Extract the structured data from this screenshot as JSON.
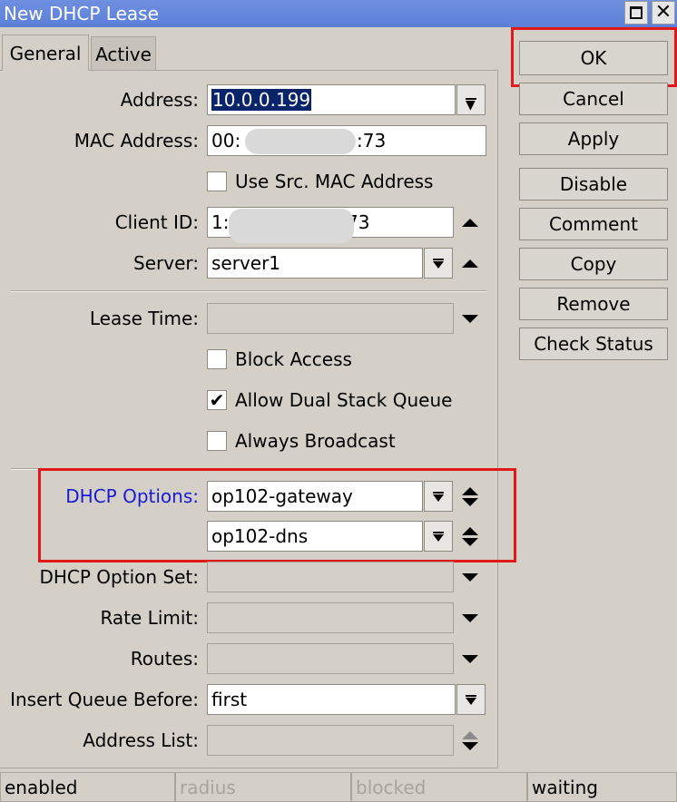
{
  "window": {
    "title": "New DHCP Lease"
  },
  "tabs": [
    {
      "label": "General"
    },
    {
      "label": "Active"
    }
  ],
  "form": {
    "address": {
      "label": "Address:",
      "value": "10.0.0.199"
    },
    "mac": {
      "label": "MAC Address:",
      "value_start": "00:",
      "value_end": ":73"
    },
    "use_src_mac": {
      "label": "Use Src. MAC Address",
      "checked": false
    },
    "client_id": {
      "label": "Client ID:",
      "value_start": "1:",
      "value_end": "73"
    },
    "server": {
      "label": "Server:",
      "value": "server1"
    },
    "lease_time": {
      "label": "Lease Time:",
      "value": ""
    },
    "block_access": {
      "label": "Block Access",
      "checked": false
    },
    "allow_dual_stack": {
      "label": "Allow Dual Stack Queue",
      "checked": true
    },
    "always_broadcast": {
      "label": "Always Broadcast",
      "checked": false
    },
    "dhcp_options": {
      "label": "DHCP Options:",
      "values": [
        "op102-gateway",
        "op102-dns"
      ]
    },
    "dhcp_option_set": {
      "label": "DHCP Option Set:",
      "value": ""
    },
    "rate_limit": {
      "label": "Rate Limit:",
      "value": ""
    },
    "routes": {
      "label": "Routes:",
      "value": ""
    },
    "insert_queue_before": {
      "label": "Insert Queue Before:",
      "value": "first"
    },
    "address_list": {
      "label": "Address List:",
      "value": ""
    }
  },
  "buttons": {
    "ok": "OK",
    "cancel": "Cancel",
    "apply": "Apply",
    "disable": "Disable",
    "comment": "Comment",
    "copy": "Copy",
    "remove": "Remove",
    "check_status": "Check Status"
  },
  "status_bar": [
    "enabled",
    "radius",
    "blocked",
    "waiting"
  ],
  "colors": {
    "title_bar": "#5b7fd8",
    "dhcp_options_label": "#1a1ad6",
    "highlight_box": "#e01818",
    "selection": "#0a246a"
  }
}
